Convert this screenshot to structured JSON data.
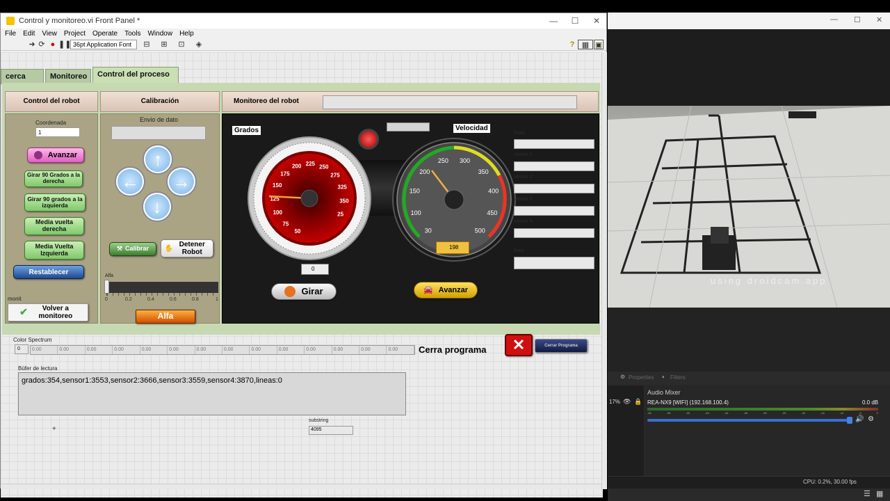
{
  "window": {
    "title": "Control y monitoreo.vi Front Panel *",
    "minimize": "—",
    "maximize": "☐",
    "close": "✕"
  },
  "menu": [
    "File",
    "Edit",
    "View",
    "Project",
    "Operate",
    "Tools",
    "Window",
    "Help"
  ],
  "toolbar": {
    "font": "36pt Application Font",
    "help": "?"
  },
  "tabs": [
    {
      "label": "cerca de..."
    },
    {
      "label": "Monitoreo"
    },
    {
      "label": "Control del proceso"
    }
  ],
  "sections": {
    "robot": "Control del robot",
    "calib": "Calibración",
    "monitor": "Monitoreo del robot"
  },
  "robot": {
    "coord_label": "Coordenada",
    "coord_value": "1",
    "avanzar": "Avanzar",
    "girar_der": "Girar 90 Grados a la derecha",
    "girar_izq": "Girar 90 grados a la izquierda",
    "media_der": "Media vuelta derecha",
    "media_izq": "Media Vuelta Izquierda",
    "reset": "Restablecer",
    "monit": "monit",
    "volver": "Volver a monitoreo"
  },
  "calib": {
    "envio": "Envio de dato",
    "calibrar": "Calibrar",
    "detener": "Detener Robot",
    "alfa": "Alfa",
    "alfa_btn": "Alfa",
    "alfa_ticks": [
      "0",
      "0.2",
      "0.4",
      "0.6",
      "0.8",
      "1"
    ],
    "alfa_value": 0
  },
  "monitor": {
    "grados_label": "Grados",
    "velocidad_label": "Velocidad",
    "grados_ticks": [
      "50",
      "75",
      "100",
      "125",
      "150",
      "175",
      "200",
      "225",
      "250",
      "275",
      "325",
      "350",
      "25"
    ],
    "vel_ticks": [
      "30",
      "100",
      "150",
      "200",
      "250",
      "300",
      "350",
      "400",
      "450",
      "500"
    ],
    "vel_value": "198",
    "girar_value": "0",
    "girar_btn": "Girar",
    "avanzar_btn": "Avanzar",
    "side_labels": [
      "Grad",
      "sensor 1",
      "sensor 2",
      "sensor 3",
      "sensor 4",
      "linea"
    ]
  },
  "spectrum": {
    "label": "Color Spectrum",
    "index": "0",
    "values": [
      "0.00",
      "0.00",
      "0.00",
      "0.00",
      "0.00",
      "0.00",
      "0.00",
      "0.00",
      "0.00",
      "0.00",
      "0.00",
      "0.00",
      "0.00",
      "0.00"
    ]
  },
  "cerrar": {
    "label": "Cerra programa",
    "btn": "Cerrar Programa"
  },
  "buffer": {
    "label": "Búfer de lectura",
    "value": "grados:354,sensor1:3553,sensor2:3666,sensor3:3559,sensor4:3870,lineas:0"
  },
  "substring": {
    "label": "substring",
    "value": "4095"
  },
  "obs": {
    "watermark": "using droidcam.app",
    "properties": "Properties",
    "filters": "Filters",
    "mixer_title": "Audio Mixer",
    "percent": "17%",
    "device": "REA-NX9 [WIFI] (192.168.100.4)",
    "db": "0.0 dB",
    "cpu": "CPU: 0.2%, 30.00 fps",
    "mixer_fraction": 0.97,
    "meter_ticks": [
      "-60",
      "-55",
      "-50",
      "-45",
      "-40",
      "-35",
      "-30",
      "-25",
      "-20",
      "-15",
      "-10",
      "-5",
      "0"
    ]
  }
}
